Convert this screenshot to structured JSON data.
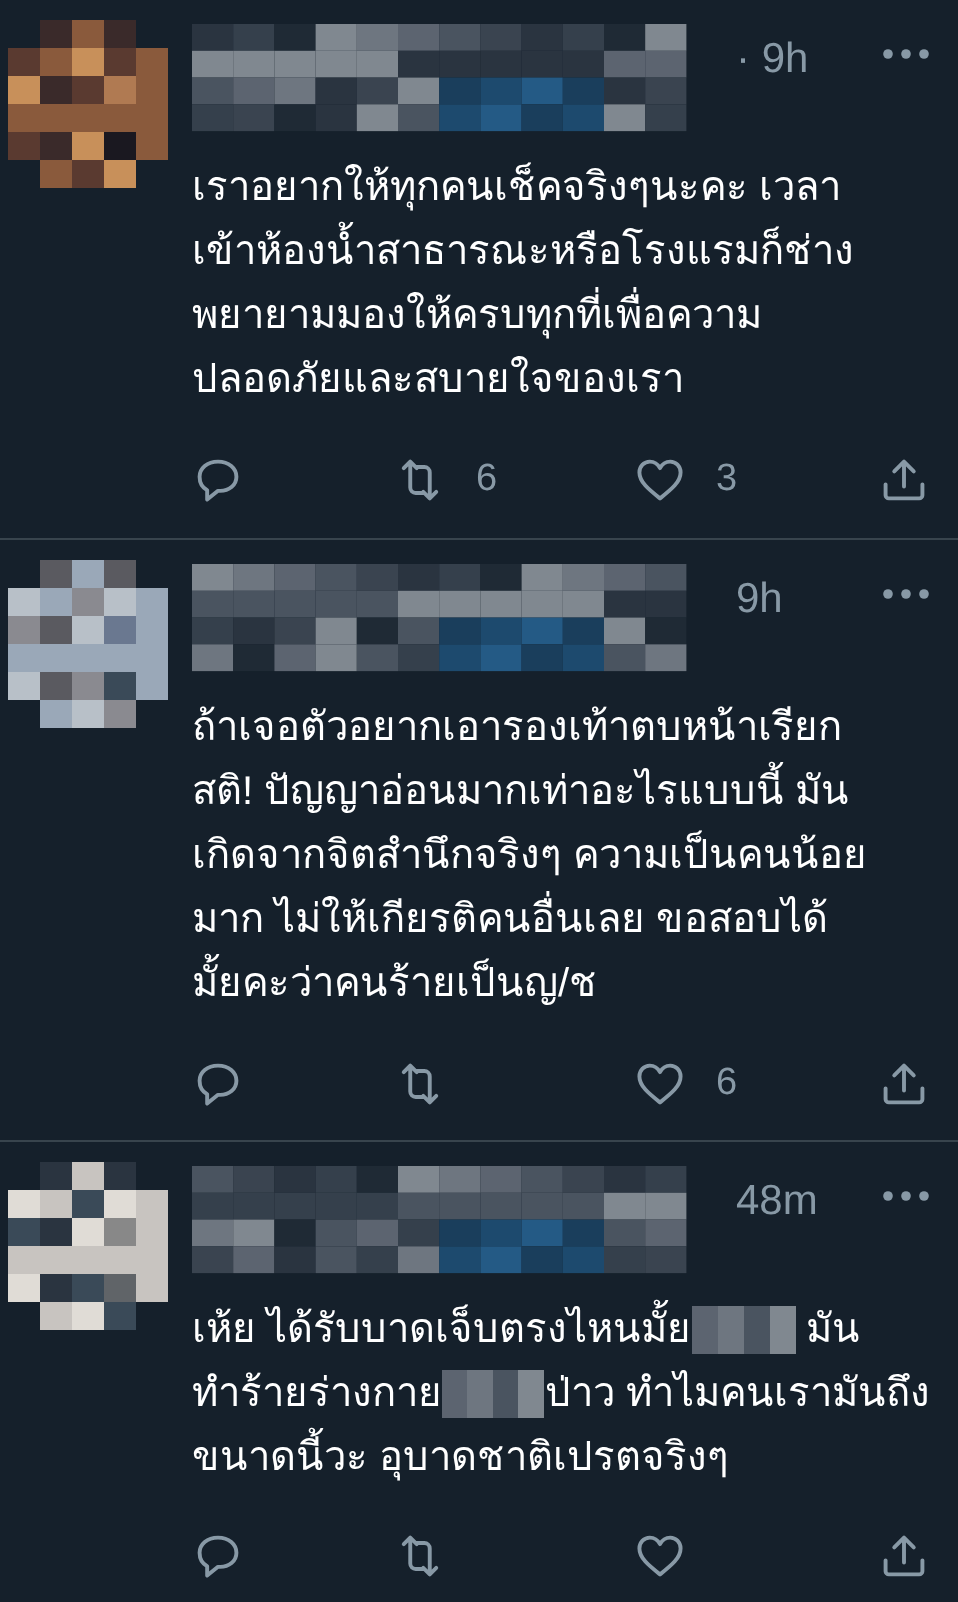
{
  "tweets": [
    {
      "time": "· 9h",
      "body": [
        [
          {
            "kind": "text",
            "text": "เราอยากให้ทุกคนเช็คจริงๆนะคะ เวลา"
          }
        ],
        [
          {
            "kind": "text",
            "text": "เข้าห้องน้ำสาธารณะหรือโรงแรมก็ช่าง"
          }
        ],
        [
          {
            "kind": "text",
            "text": "พยายามมองให้ครบทุกที่เพื่อความ"
          }
        ],
        [
          {
            "kind": "text",
            "text": "ปลอดภัยและสบายใจของเรา"
          }
        ]
      ],
      "retweets": "6",
      "likes": "3"
    },
    {
      "time": "9h",
      "body": [
        [
          {
            "kind": "text",
            "text": "ถ้าเจอตัวอยากเอารองเท้าตบหน้าเรียก"
          }
        ],
        [
          {
            "kind": "text",
            "text": "สติ! ปัญญาอ่อนมากเท่าอะไรแบบนี้ มัน"
          }
        ],
        [
          {
            "kind": "text",
            "text": "เกิดจากจิตสำนึกจริงๆ ความเป็นคนน้อย"
          }
        ],
        [
          {
            "kind": "text",
            "text": "มาก ไม่ให้เกียรติคนอื่นเลย ขอสอบได้"
          }
        ],
        [
          {
            "kind": "text",
            "text": "มั้ยคะว่าคนร้ายเป็นญ/ช"
          }
        ]
      ],
      "likes": "6"
    },
    {
      "time": "48m",
      "body": [
        [
          {
            "kind": "text",
            "text": "เห้ย ได้รับบาดเจ็บตรงไหนมั้ย"
          },
          {
            "kind": "redacted"
          },
          {
            "kind": "text",
            "text": " มัน"
          }
        ],
        [
          {
            "kind": "text",
            "text": "ทำร้ายร่างกาย"
          },
          {
            "kind": "redacted"
          },
          {
            "kind": "text",
            "text": "ป่าว ทำไมคนเรามันถึง"
          }
        ],
        [
          {
            "kind": "text",
            "text": "ขนาดนี้วะ อุบาดชาติเปรตจริงๆ"
          }
        ]
      ]
    }
  ]
}
